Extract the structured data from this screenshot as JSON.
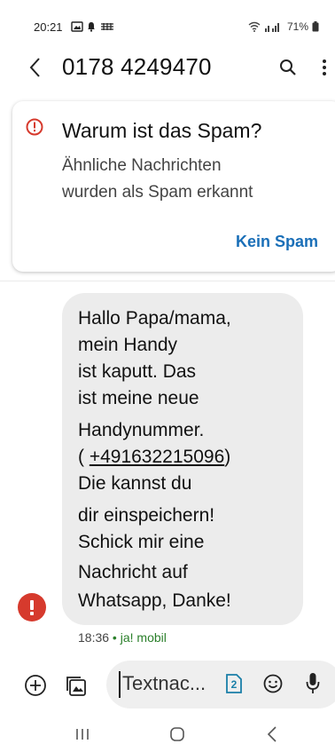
{
  "status_bar": {
    "time": "20:21",
    "battery": "71%"
  },
  "header": {
    "title": "0178 4249470"
  },
  "spam_card": {
    "title": "Warum ist das Spam?",
    "subtitle_line1": "Ähnliche Nachrichten",
    "subtitle_line2": "wurden als Spam erkannt",
    "button": "Kein Spam",
    "accent_color": "#1a6fb8",
    "warning_color": "#d63a2d"
  },
  "message": {
    "lines": [
      "Hallo Papa/mama,",
      "mein Handy",
      "ist kaputt. Das",
      "ist meine neue",
      "Handynummer.",
      "( +491632215096)",
      "Die kannst du",
      "dir einspeichern!",
      "Schick  mir eine",
      "Nachricht auf",
      "Whatsapp, Danke!"
    ],
    "phone_number": "+491632215096",
    "time": "18:36",
    "separator": " • ",
    "sender": "ja! mobil"
  },
  "compose": {
    "placeholder": "Textnac...",
    "sim_label": "2"
  },
  "icons": {
    "back": "chevron-left-icon",
    "search": "search-icon",
    "more": "more-vertical-icon",
    "warning": "alert-circle-icon",
    "add": "add-circle-icon",
    "gallery": "gallery-icon",
    "emoji": "emoji-icon",
    "mic": "mic-icon"
  }
}
